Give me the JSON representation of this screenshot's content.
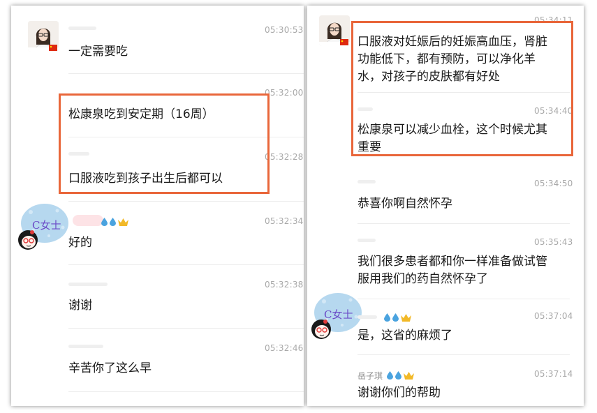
{
  "left": {
    "messages": [
      {
        "time": "05:30:53",
        "text": "一定需要吃"
      },
      {
        "time": "05:32:00",
        "text": "松康泉吃到安定期（16周）"
      },
      {
        "time": "05:32:28",
        "text": "口服液吃到孩子出生后都可以"
      },
      {
        "time": "05:32:34",
        "text": "好的"
      },
      {
        "time": "05:32:38",
        "text": "谢谢"
      },
      {
        "time": "05:32:46",
        "text": "辛苦你了这么早"
      }
    ],
    "avatar_label": "C女士"
  },
  "right": {
    "messages": [
      {
        "time": "05:34:11",
        "lines": [
          "口服液对妊娠后的妊娠高血压，肾脏",
          "功能低下，都有预防，可以净化羊",
          "水，对孩子的皮肤都有好处"
        ]
      },
      {
        "time": "05:34:40",
        "lines": [
          "松康泉可以减少血栓，这个时候尤其",
          "重要"
        ]
      },
      {
        "time": "05:34:50",
        "lines": [
          "恭喜你啊自然怀孕"
        ]
      },
      {
        "time": "05:35:43",
        "lines": [
          "我们很多患者都和你一样准备做试管",
          "服用我们的药自然怀孕了"
        ]
      },
      {
        "time": "05:37:04",
        "lines": [
          "是，这省的麻烦了"
        ]
      },
      {
        "time": "05:37:14",
        "sender": "岳子琪",
        "lines": [
          "谢谢你们的帮助"
        ]
      }
    ],
    "avatar_label": "C女士"
  },
  "colors": {
    "highlight": "#e9663a",
    "timestamp": "#a9a9a9",
    "drop": "#4aa3df",
    "crown": "#f2b928"
  }
}
